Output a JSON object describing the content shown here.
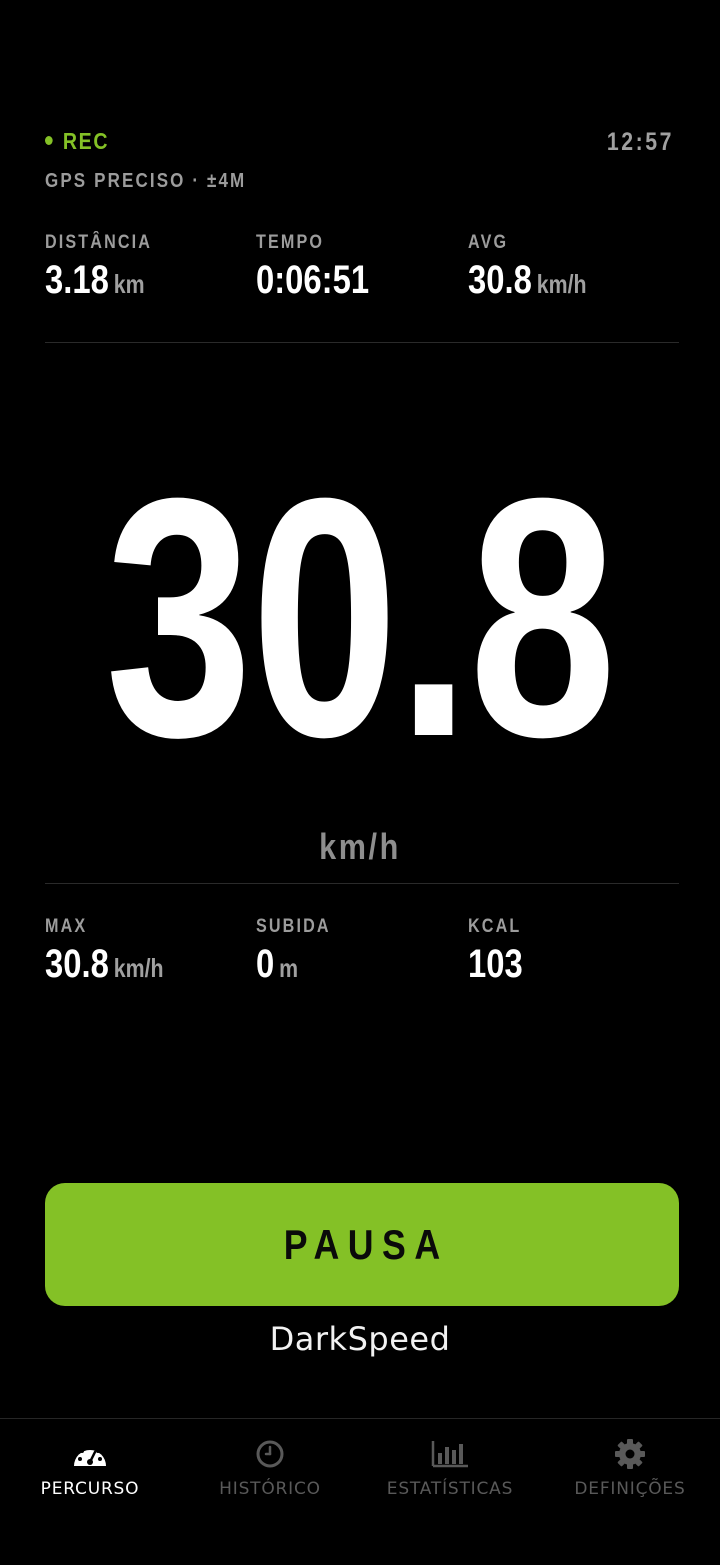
{
  "status": {
    "rec_label": "REC",
    "time": "12:57",
    "gps_text": "GPS PRECISO · ±4M"
  },
  "top_stats": [
    {
      "label": "DISTÂNCIA",
      "value": "3.18",
      "unit": "km"
    },
    {
      "label": "TEMPO",
      "value": "0:06:51",
      "unit": ""
    },
    {
      "label": "AVG",
      "value": "30.8",
      "unit": "km/h"
    }
  ],
  "speed": {
    "value": "30.8",
    "unit": "km/h"
  },
  "bottom_stats": [
    {
      "label": "MAX",
      "value": "30.8",
      "unit": "km/h"
    },
    {
      "label": "SUBIDA",
      "value": "0",
      "unit": "m"
    },
    {
      "label": "KCAL",
      "value": "103",
      "unit": ""
    }
  ],
  "actions": {
    "pause_label": "PAUSA"
  },
  "brand": "DarkSpeed",
  "nav": [
    {
      "label": "PERCURSO",
      "icon": "speedometer-icon",
      "active": true
    },
    {
      "label": "HISTÓRICO",
      "icon": "clock-icon",
      "active": false
    },
    {
      "label": "ESTATÍSTICAS",
      "icon": "bar-chart-icon",
      "active": false
    },
    {
      "label": "DEFINIÇÕES",
      "icon": "gear-icon",
      "active": false
    }
  ],
  "colors": {
    "background": "#000000",
    "accent": "#84c126",
    "muted_text": "#9c9c9c",
    "inactive_nav": "#595959"
  }
}
